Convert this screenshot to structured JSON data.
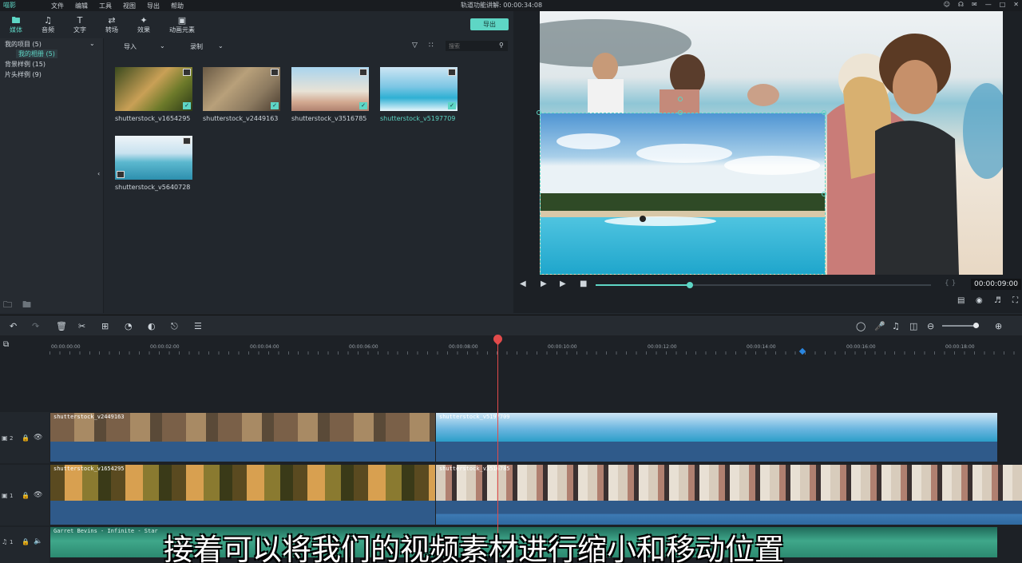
{
  "menubar": {
    "logo": "喵影",
    "items": [
      "文件",
      "编辑",
      "工具",
      "视图",
      "导出",
      "帮助"
    ],
    "title": "轨道功能讲解: 00:00:34:08",
    "window_icons": [
      "user-icon",
      "cart-icon",
      "mail-icon",
      "minimize-icon",
      "maximize-icon",
      "close-icon"
    ]
  },
  "nav": {
    "tabs": [
      {
        "label": "媒体",
        "icon": "folder-icon"
      },
      {
        "label": "音频",
        "icon": "music-icon"
      },
      {
        "label": "文字",
        "icon": "text-icon"
      },
      {
        "label": "转场",
        "icon": "transition-icon"
      },
      {
        "label": "效果",
        "icon": "effects-icon"
      },
      {
        "label": "动画元素",
        "icon": "image-icon"
      }
    ],
    "export_label": "导出"
  },
  "leftpanel": {
    "items": [
      "我的项目 (5)",
      "我的相册 (5)",
      "背景样例 (15)",
      "片头样例 (9)"
    ]
  },
  "mediabar": {
    "import_label": "导入",
    "record_label": "录制",
    "search_placeholder": "搜索"
  },
  "media": [
    {
      "name": "shutterstock_v1654295",
      "checked": true
    },
    {
      "name": "shutterstock_v2449163",
      "checked": true
    },
    {
      "name": "shutterstock_v3516785",
      "checked": true
    },
    {
      "name": "shutterstock_v5197709",
      "checked": true
    },
    {
      "name": "shutterstock_v5640728",
      "checked": false
    }
  ],
  "preview": {
    "timecode": "00:00:09:00",
    "progress": 0.28
  },
  "ruler": {
    "ticks": [
      "00:00:00:00",
      "00:00:02:00",
      "00:00:04:00",
      "00:00:06:00",
      "00:00:08:00",
      "00:00:10:00",
      "00:00:12:00",
      "00:00:14:00",
      "00:00:16:00",
      "00:00:18:00"
    ]
  },
  "tracks": {
    "video2": {
      "num": "2",
      "clips": [
        "shutterstock_v2449163",
        "shutterstock_v5197709"
      ]
    },
    "video1": {
      "num": "1",
      "clips": [
        "shutterstock_v1654295",
        "shutterstock_v3516785"
      ]
    },
    "audio1": {
      "num": "1",
      "clips": [
        "Garret Bevins - Infinite - Star"
      ]
    }
  },
  "subtitle": "接着可以将我们的视频素材进行缩小和移动位置"
}
